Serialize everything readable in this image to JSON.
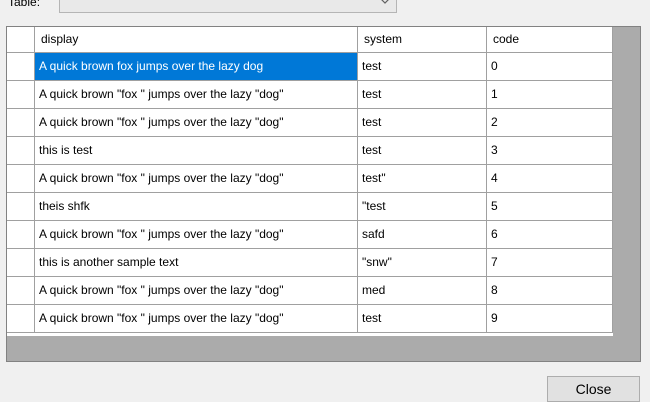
{
  "table_selector": {
    "label": "Table:",
    "value": ""
  },
  "grid": {
    "columns": [
      "display",
      "system",
      "code"
    ],
    "rows": [
      {
        "display": "A quick brown fox jumps over the lazy dog",
        "system": "test",
        "code": "0",
        "selected_display": true
      },
      {
        "display": "A quick brown \"fox \" jumps over the lazy \"dog\"",
        "system": "test",
        "code": "1"
      },
      {
        "display": "A quick brown \"fox \" jumps over the lazy \"dog\"",
        "system": "test",
        "code": "2"
      },
      {
        "display": "this is test",
        "system": "test",
        "code": "3"
      },
      {
        "display": "A quick brown \"fox \" jumps over the lazy \"dog\"",
        "system": "test\"",
        "code": "4"
      },
      {
        "display": "theis shfk",
        "system": "\"test",
        "code": "5"
      },
      {
        "display": "A quick brown \"fox \" jumps over the lazy \"dog\"",
        "system": "safd",
        "code": "6"
      },
      {
        "display": "this is another sample text",
        "system": "\"snw\"",
        "code": "7"
      },
      {
        "display": "A quick brown \"fox \" jumps over the lazy \"dog\"",
        "system": "med",
        "code": "8"
      },
      {
        "display": "A quick brown \"fox \" jumps over the lazy \"dog\"",
        "system": "test",
        "code": "9"
      }
    ]
  },
  "buttons": {
    "close_label": "Close"
  },
  "colors": {
    "selection": "#0078d7",
    "grid_background": "#ababab",
    "window_background": "#f0f0f0"
  }
}
